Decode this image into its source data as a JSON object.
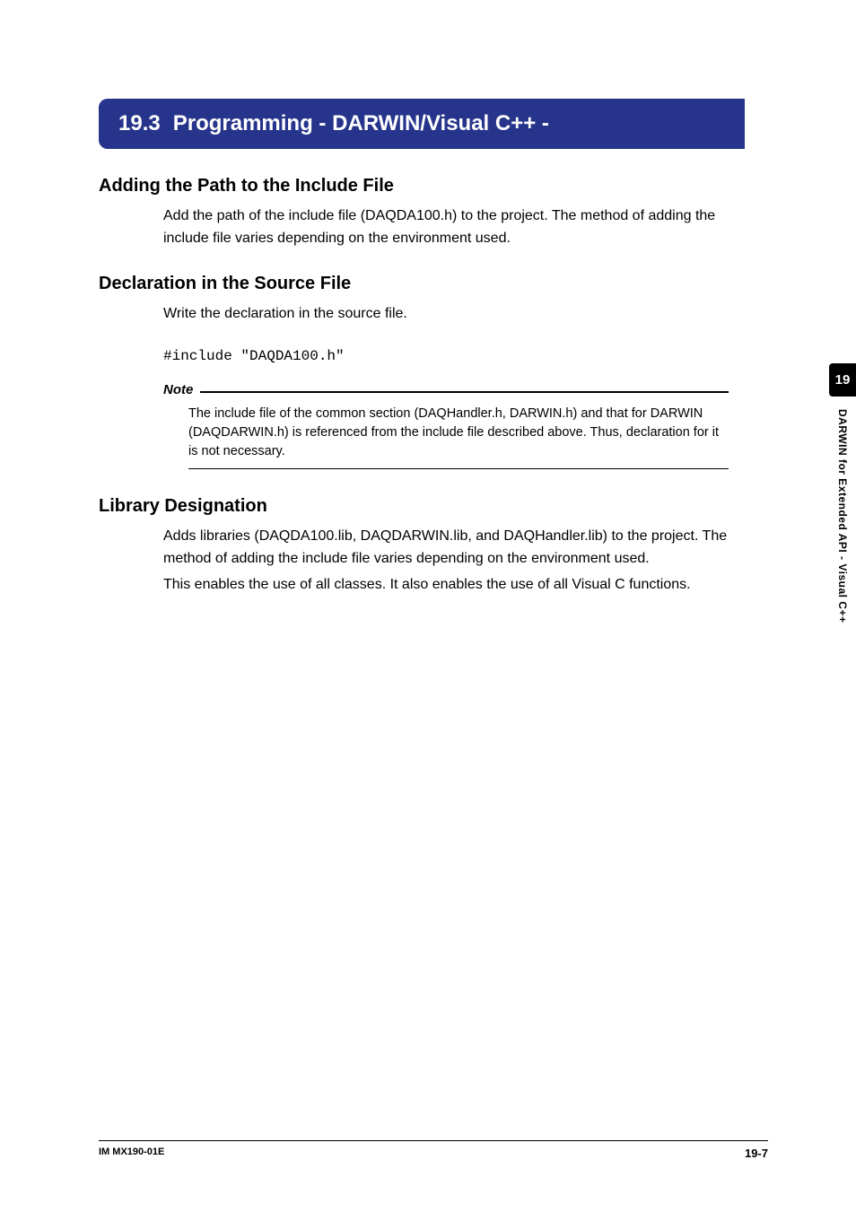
{
  "banner": {
    "number": "19.3",
    "title": "Programming - DARWIN/Visual C++ -"
  },
  "sections": {
    "s1": {
      "heading": "Adding the Path to the Include File",
      "body": "Add the path of the include file (DAQDA100.h) to the project. The method of adding the include file varies depending on the environment used."
    },
    "s2": {
      "heading": "Declaration in the Source File",
      "body": "Write the declaration in the source file.",
      "code": "#include \"DAQDA100.h\""
    },
    "note": {
      "label": "Note",
      "text": "The include file of the common section (DAQHandler.h, DARWIN.h) and that for DARWIN (DAQDARWIN.h) is referenced from the include file described above. Thus, declaration for it is not necessary."
    },
    "s3": {
      "heading": "Library Designation",
      "body1": "Adds libraries (DAQDA100.lib, DAQDARWIN.lib, and DAQHandler.lib) to the project. The method of adding the include file varies depending on the environment used.",
      "body2": "This enables the use of all classes. It also enables the use of all Visual C functions."
    }
  },
  "sidetab": {
    "chapter": "19",
    "label": "DARWIN for Extended API - Visual C++"
  },
  "footer": {
    "left": "IM MX190-01E",
    "right": "19-7"
  }
}
